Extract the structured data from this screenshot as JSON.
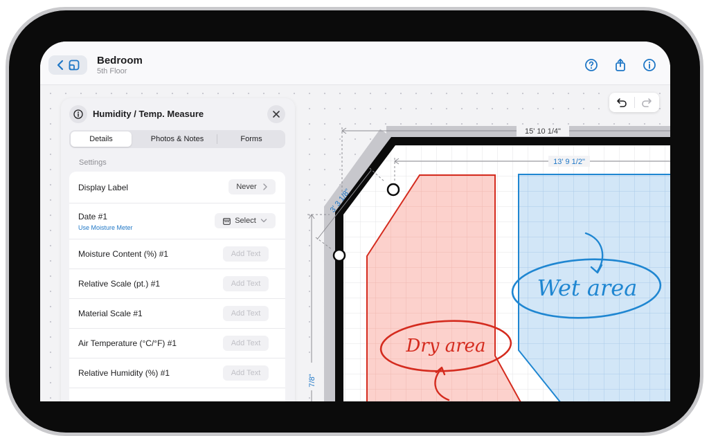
{
  "header": {
    "room_name": "Bedroom",
    "floor": "5th Floor"
  },
  "icons": {
    "back": "chevron-left-icon",
    "plan": "floor-plan-icon",
    "help": "question-circle-icon",
    "share": "share-icon",
    "info": "info-circle-icon",
    "undo": "undo-icon",
    "redo": "redo-icon",
    "close": "close-icon"
  },
  "panel": {
    "title": "Humidity / Temp. Measure",
    "tabs": [
      {
        "label": "Details",
        "active": true
      },
      {
        "label": "Photos & Notes",
        "active": false
      },
      {
        "label": "Forms",
        "active": false
      }
    ],
    "section_title": "Settings",
    "fields": {
      "display_label": {
        "label": "Display Label",
        "value": "Never"
      },
      "date": {
        "label": "Date #1",
        "sublabel": "Use Moisture Meter",
        "value": "Select"
      },
      "moisture": {
        "label": "Moisture Content (%) #1",
        "placeholder": "Add Text"
      },
      "relative_scale": {
        "label": "Relative Scale (pt.) #1",
        "placeholder": "Add Text"
      },
      "material_scale": {
        "label": "Material Scale #1",
        "placeholder": "Add Text"
      },
      "air_temp": {
        "label": "Air Temperature (°C/°F) #1",
        "placeholder": "Add Text"
      },
      "humidity": {
        "label": "Relative Humidity (%) #1",
        "placeholder": "Add Text"
      }
    }
  },
  "plan": {
    "dims": {
      "overall": "15' 10 1/4\"",
      "wall": "13' 9 1/2\"",
      "diagonal": "3' 3 1/8\"",
      "left": "7/8\""
    },
    "annotations": {
      "dry": "Dry area",
      "wet": "Wet area"
    }
  },
  "colors": {
    "accent": "#1f77c6",
    "dry": "#d42b1e",
    "wet": "#1f86d1"
  }
}
